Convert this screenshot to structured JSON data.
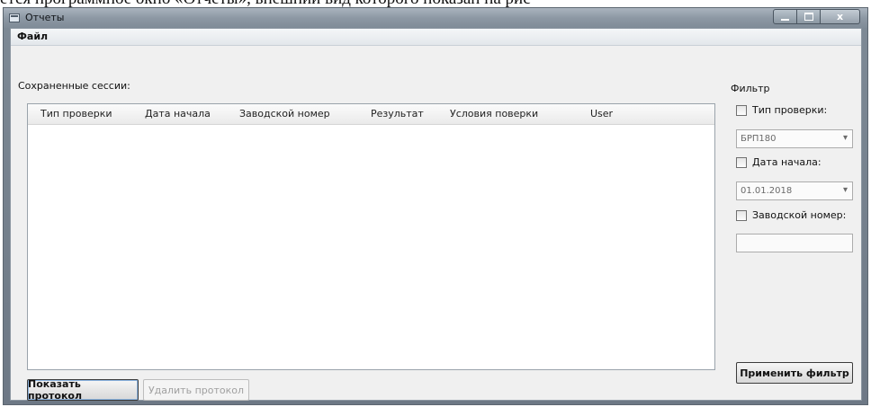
{
  "document_text": "ется программное окно «Отчеты», внешний вид которого показан на рис",
  "window": {
    "title": "Отчеты",
    "controls": {
      "minimize": "",
      "maximize": "",
      "close": "x"
    }
  },
  "menu": {
    "file": "Файл"
  },
  "sessions": {
    "label": "Сохраненные сессии:",
    "columns": [
      "Тип проверки",
      "Дата начала",
      "Заводской номер",
      "Результат",
      "Условия поверки",
      "User"
    ],
    "rows": []
  },
  "buttons": {
    "show_protocol": "Показать протокол",
    "delete_protocol": "Удалить протокол",
    "apply_filter": "Применить фильтр"
  },
  "filter": {
    "title": "Фильтр",
    "check_type_label": "Тип проверки:",
    "check_type_value": "БРП180",
    "start_date_label": "Дата начала:",
    "start_date_value": "01.01.2018",
    "serial_label": "Заводской номер:",
    "serial_value": ""
  }
}
